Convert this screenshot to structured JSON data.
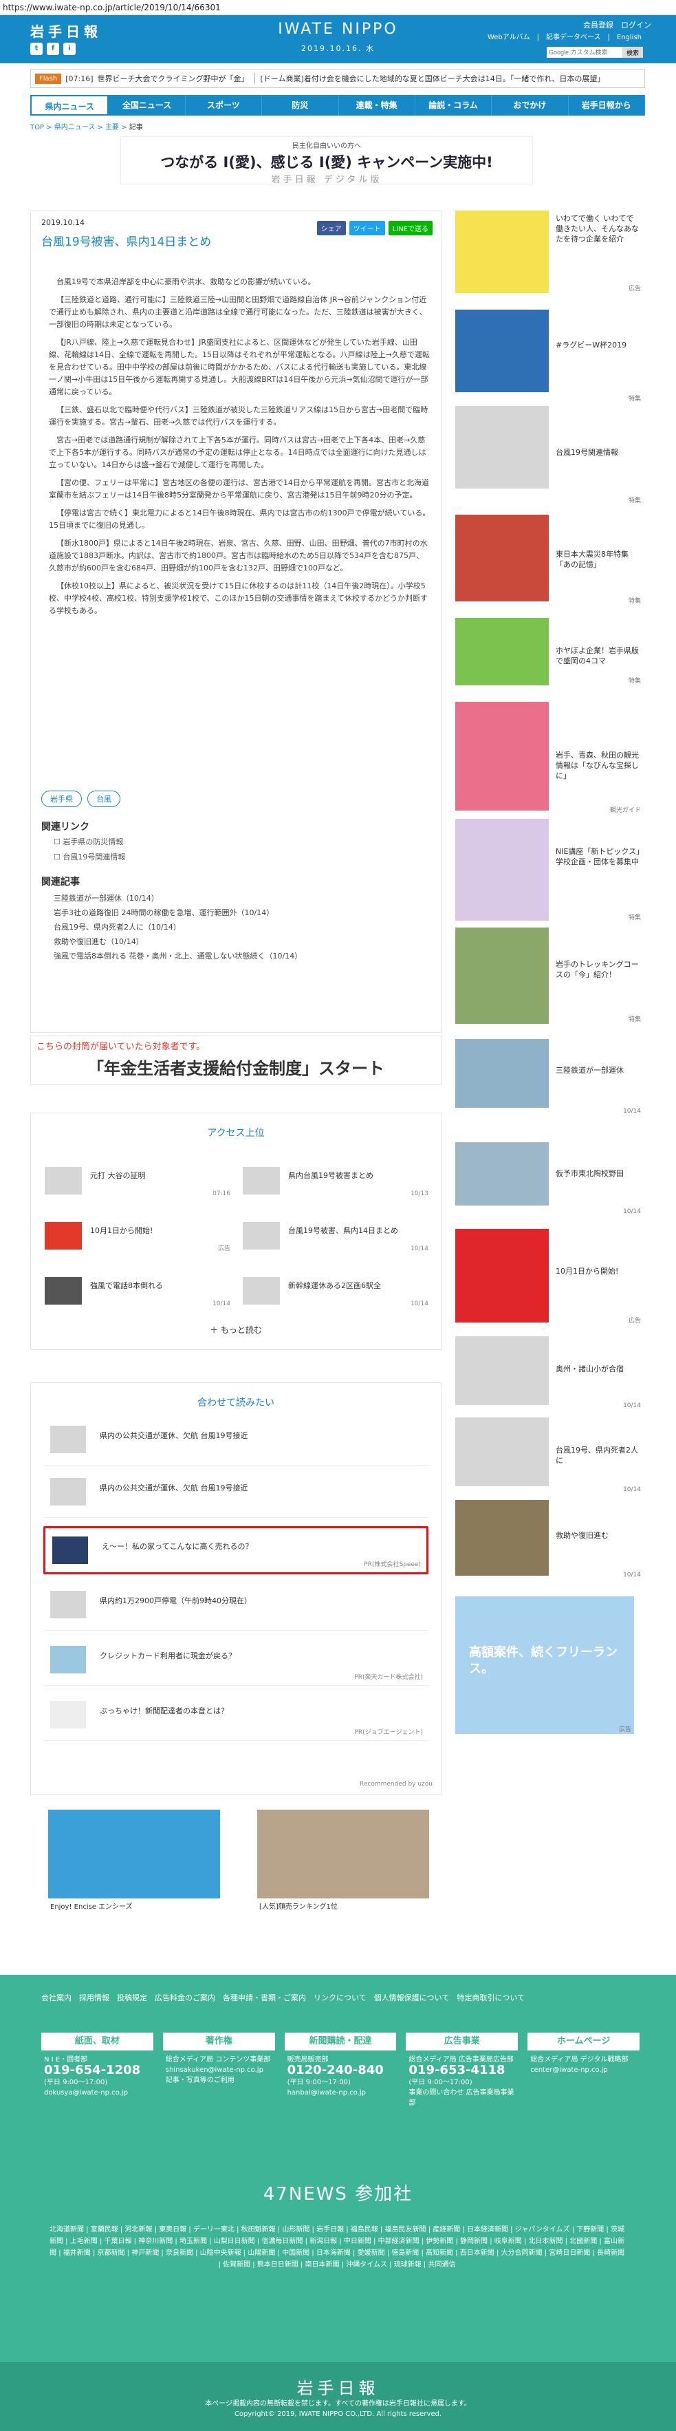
{
  "url": "https://www.iwate-np.co.jp/article/2019/10/14/66301",
  "header": {
    "logo": "岩手日報",
    "brand": "IWATE NIPPO",
    "date": "2019.10.16. 水",
    "login": "会員登録　ログイン",
    "links": "Webアルバム　|　記事データベース　|　English",
    "search_placeholder": "Google カスタム検索",
    "search_button": "検索",
    "social": [
      "t",
      "f",
      "i"
    ]
  },
  "ticker": {
    "badge": "Flash",
    "time": "[07:16]",
    "t1": "世界ビーチ大会でクライミング野中が「金」",
    "t2": "[ドーム商業]着付け会を機会にした地域的な夏と国体ビーチ大会は14日。「一緒で作れ、日本の展望」"
  },
  "nav": [
    "県内ニュース",
    "全国ニュース",
    "スポーツ",
    "防災",
    "連載・特集",
    "論説・コラム",
    "おでかけ",
    "岩手日報から"
  ],
  "breadcrumb": {
    "a": "TOP",
    "b": "県内ニュース",
    "c": "主要",
    "d": "記事"
  },
  "banner1": {
    "small": "民主化自由いいの方へ",
    "main": "つながる I(愛)、感じる I(愛) キャンペーン実施中!",
    "logo": "岩手日報 デジタル版"
  },
  "article": {
    "date": "2019.10.14",
    "title": "台風19号被害、県内14日まとめ",
    "share": [
      "シェア",
      "ツイート",
      "LINEで送る"
    ],
    "paras": [
      "台風19号で本県沿岸部を中心に豪雨や洪水、救助などの影響が続いている。",
      "【三陸鉄道と道路、通行可能に】三陸鉄道三陸→山田間と田野畑で道路線自治体 JR→谷前ジャンクション付近で通行止めも解除され、県内の主要道と沿岸道路は全線で通行可能になった。ただ、三陸鉄道は被害が大きく、一部復旧の時期は未定となっている。",
      "【JR八戸線、陸上→久慈で運転見合わせ】JR盛岡支社によると、区間運休などが発生していた岩手線、山田線、花輪線は14日、全線で運転を再開した。15日以降はそれぞれが平常運転となる。八戸線は陸上→久慈で運転を見合わせている。田中中学校の部屋は前後に時間がかかるため、バスによる代行輸送も実施している。東北線一ノ関→小牛田は15日午後から運転再開する見通し。大船渡線BRTは14日午後から元浜→気仙沼間で運行が一部通常に戻っている。",
      "【三鉄、盛石以北で臨時便や代行バス】三陸鉄道が被災した三陸鉄道リアス線は15日から宮古→田老間で臨時運行を実施する。宮古→釜石、田老→久慈では代行バスを運行する。",
      "宮古→田老では道路通行規制が解除されて上下各5本が運行。同時バスは宮古→田老で上下各4本、田老→久慈で上下各5本が運行する。同時バスが通常の予定の運転は停止となる。14日時点では全面運行に向けた見通しは立っていない。14日からは盛→釜石で減便して運行を再開した。",
      "【宮の便、フェリーは平常に】宮古地区の各便の運行は、宮古港で14日から平常運航を再開。宮古市と北海道室蘭市を結ぶフェリーは14日午後8時5分室蘭発から平常運航に戻り、宮古港発は15日午前9時20分の予定。",
      "【停電は宮古で続く】東北電力によると14日午後8時現在、県内では宮古市の約1300戸で停電が続いている。15日頃までに復旧の見通し。",
      "【断水1800戸】県によると14日午後2時現在、岩泉、宮古、久慈、田野、山田、田野畑、普代の7市町村の水道施設で1883戸断水。内訳は、宮古市で約1800戸。宮古市は臨時給水のため5日以降で534戸を含む875戸、久慈市が約600戸を含む684戸、田野畑が約100戸を含む132戸、田野畑で100戸など。",
      "【休校10校以上】県によると、被災状況を受けて15日に休校するのは計11校（14日午後2時現在）。小学校5校、中学校4校、高校1校、特別支援学校1校で、このほか15日朝の交通事情を踏まえて休校するかどうか判断する学校もある。"
    ],
    "tags": [
      "岩手県",
      "台風"
    ],
    "rel_link_title": "関連リンク",
    "rel_links": [
      "岩手県の防災情報",
      "台風19号関連情報"
    ],
    "rel_news_title": "関連記事",
    "rel_news": [
      "三陸鉄道が一部運休（10/14）",
      "岩手3社の道路復旧  24時間の稼働を急増、運行範囲外（10/14）",
      "台風19号、県内死者2人に（10/14）",
      "救助や復旧進む（10/14）",
      "強風で電話8本倒れる  花巻・奥州・北上、通電しない状態続く（10/14）"
    ]
  },
  "banner2": {
    "small": "こちらの封筒が届いていたら対象者です。",
    "main": "「年金生活者支援給付金制度」スタート"
  },
  "access": {
    "title": "アクセス上位",
    "items": [
      {
        "text": "元打  大谷の証明",
        "date": "07:16"
      },
      {
        "text": "県内台風19号被害まとめ",
        "date": "10/13"
      },
      {
        "text": "10月1日から開始!",
        "date": "広告"
      },
      {
        "text": "台風19号被害、県内14日まとめ",
        "date": "10/14"
      },
      {
        "text": "強風で電話8本倒れる",
        "date": "10/14"
      },
      {
        "text": "新幹線運休ある2区画6駅全",
        "date": "10/14"
      }
    ],
    "more": "もっと読む"
  },
  "recommend": {
    "title": "合わせて読みたい",
    "items": [
      {
        "text": "県内の公共交通が運休、欠航  台風19号接近",
        "sponsor": ""
      },
      {
        "text": "県内の公共交通が運休、欠航  台風19号接近",
        "sponsor": ""
      },
      {
        "text": "え〜ー！私の家ってこんなに高く売れるの？",
        "sponsor": "PR(株式会社Speee)"
      },
      {
        "text": "県内約1万2900戸停電（午前9時40分現在）",
        "sponsor": ""
      },
      {
        "text": "クレジットカード利用者に現金が戻る？",
        "sponsor": "PR(楽天カード株式会社)"
      },
      {
        "text": "ぶっちゃけ！新聞配達者の本音とは？",
        "sponsor": "PR(ジョブエージェント)"
      }
    ],
    "credit": "Recommended by  uzou"
  },
  "ads": [
    {
      "caption": "Enjoy! Encise エンシーズ"
    },
    {
      "caption": "[人気]顔売ランキング1位"
    }
  ],
  "sidebar": [
    {
      "text": "いわてで働く  いわてで働きたい人、そんなあなたを待つ企業を紹介",
      "date": "広告"
    },
    {
      "text": "#ラグビーW杯2019",
      "date": "特集"
    },
    {
      "text": "台風19号関連情報",
      "date": "特集"
    },
    {
      "text": "東日本大震災8年特集「あの記憶」",
      "date": "特集"
    },
    {
      "text": "ホヤぼよ企業！岩手県版で盛岡の4コマ",
      "date": "特集"
    },
    {
      "text": "岩手、青森、秋田の観光情報は「なびんな宝探しに」",
      "date": "観光ガイド"
    },
    {
      "text": "NIE講座「新トピックス」学校企画・団体を募集中",
      "date": "特集"
    },
    {
      "text": "岩手のトレッキングコースの「今」紹介！",
      "date": "特集"
    },
    {
      "text": "三陸鉄道が一部運休",
      "date": "10/14"
    },
    {
      "text": "仮予市東北陶校野田",
      "date": "10/14"
    },
    {
      "text": "10月1日から開始!",
      "date": "広告"
    },
    {
      "text": "奥州・諸山小が合宿",
      "date": "10/14"
    },
    {
      "text": "台風19号、県内死者2人に",
      "date": "10/14"
    },
    {
      "text": "救助や復旧進む",
      "date": "10/14"
    },
    {
      "text": "高額案件、続くフリーランス。",
      "date": "広告"
    }
  ],
  "footer": {
    "links": "会社案内　採用情報　投稿規定　広告料金のご案内　各種申請・書類・ご案内　リンクについて　個人情報保護について　特定商取引について",
    "cols": [
      {
        "h": "紙面、取材",
        "b1": "N I E・囲者部",
        "tel": "019-654-1208",
        "b2": "(平日 9:00～17:00)",
        "b3": "dokusya@iwate-np.co.jp"
      },
      {
        "h": "著作権",
        "b1": "総合メディア局 コンテンツ事業部",
        "tel": "",
        "b2": "shinsakuken@iwate-np.co.jp",
        "b3": "記事・写真等のご利用"
      },
      {
        "h": "新聞購読・配達",
        "b1": "販売局販売部",
        "tel": "0120-240-840",
        "b2": "(平日 9:00～17:00)",
        "b3": "hanbai@iwate-np.co.jp"
      },
      {
        "h": "広告事業",
        "b1": "総合メディア局 広告事業局広告部",
        "tel": "019-653-4118",
        "b2": "(平日 9:00～17:00)",
        "b3": "事業の問い合わせ 広告事業局事業部"
      },
      {
        "h": "ホームページ",
        "b1": "総合メディア局 デジタル戦略部",
        "tel": "",
        "b2": "center@iwate-np.co.jp",
        "b3": ""
      }
    ],
    "p47": "47NEWS 参加社",
    "papers": "北海道新聞 | 室蘭民報 | 河北新報 | 東奥日報 | デーリー東北 | 秋田魁新報 | 山形新聞 | 岩手日報 | 福島民報 | 福島民友新聞 | 産経新聞 | 日本経済新聞 | ジャパンタイムズ | 下野新聞 | 茨城新聞 | 上毛新聞 | 千葉日報 | 神奈川新聞 | 埼玉新聞 | 山梨日日新聞 | 信濃毎日新聞 | 新潟日報 | 中日新聞 | 中部経済新聞 | 伊勢新聞 | 静岡新聞 | 岐阜新聞 | 北日本新聞 | 北國新聞 | 富山新聞 | 福井新聞 | 京都新聞 | 神戸新聞 | 奈良新聞 | 山陰中央新報 | 山陽新聞 | 中国新聞 | 日本海新聞 | 愛媛新聞 | 徳島新聞 | 高知新聞 | 西日本新聞 | 大分合同新聞 | 宮崎日日新聞 | 長崎新聞 | 佐賀新聞 | 熊本日日新聞 | 南日本新聞 | 沖縄タイムス | 琉球新報 | 共同通信",
    "logo": "岩手日報",
    "copy1": "本ページ掲載内容の無断転載を禁じます。すべての著作権は岩手日報社に帰属します。",
    "copy2": "Copyright© 2019, IWATE NIPPO CO.,LTD. All rights reserved."
  }
}
